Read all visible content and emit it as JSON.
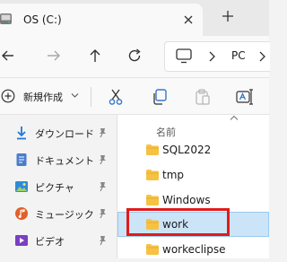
{
  "window": {
    "tab_title": "OS (C:)",
    "address_segment": "PC"
  },
  "command_bar": {
    "new_label": "新規作成"
  },
  "sidebar": {
    "items": [
      {
        "label": "ダウンロード",
        "icon": "download-icon"
      },
      {
        "label": "ドキュメント",
        "icon": "document-icon"
      },
      {
        "label": "ピクチャ",
        "icon": "picture-icon"
      },
      {
        "label": "ミュージック",
        "icon": "music-icon"
      },
      {
        "label": "ビデオ",
        "icon": "video-icon"
      }
    ]
  },
  "content": {
    "column_name": "名前",
    "rows": [
      {
        "label": "SQL2022"
      },
      {
        "label": "tmp"
      },
      {
        "label": "Windows"
      },
      {
        "label": "work",
        "selected": true
      },
      {
        "label": "workeclipse"
      }
    ]
  },
  "colors": {
    "folder": "#f6c244",
    "selection": "#cce4f7",
    "highlight": "#e01b1b",
    "download": "#1f7ad6",
    "document": "#4a7cc9",
    "picture": "#2f8bd8",
    "music": "#e0602a",
    "video": "#7a3fc4"
  }
}
